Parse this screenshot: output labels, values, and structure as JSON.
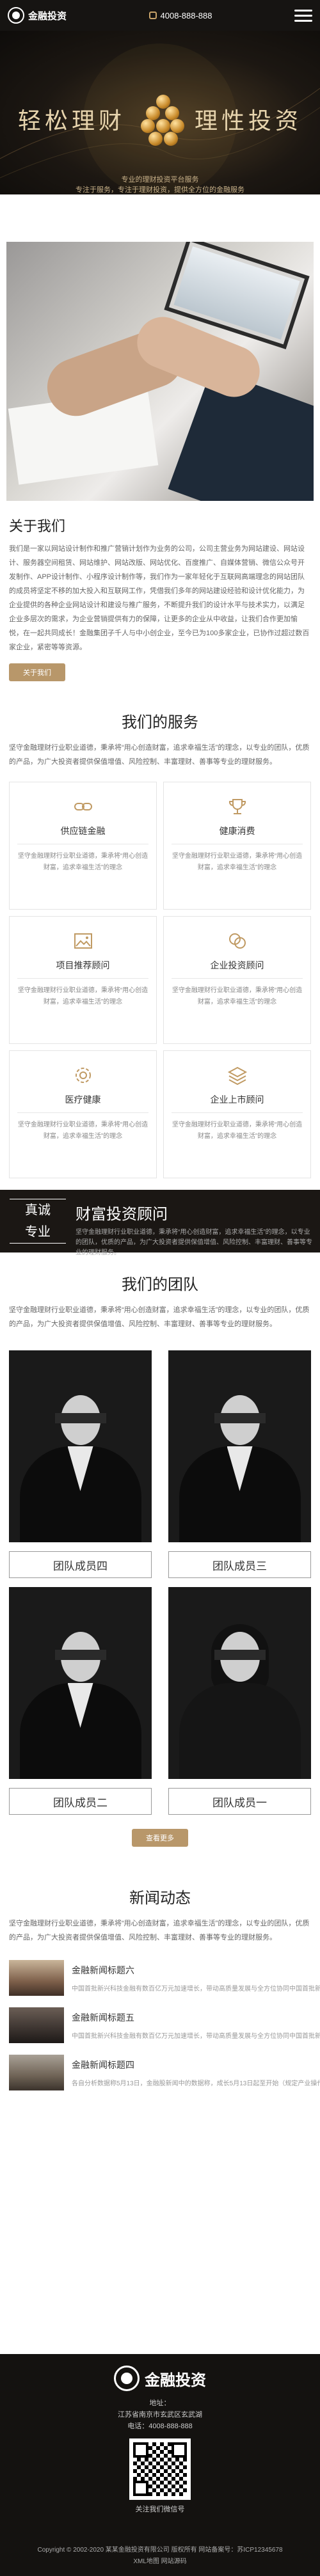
{
  "header": {
    "logo_text": "金融投资",
    "phone": "4008-888-888"
  },
  "banner": {
    "title_left": "轻松理财",
    "title_right": "理性投资",
    "sub_line1": "专业的理财投资平台服务",
    "sub_line2": "专注于服务，专注于理财投资，提供全方位的金融服务"
  },
  "about": {
    "title": "关于我们",
    "text": "我们是一家以网站设计制作和推广营销计划作为业务的公司，公司主营业务为网站建设、网站设计、服务器空间租赁、网站维护、网站改版、网站优化、百度推广、自媒体营销、微信公众号开发制作、APP设计制作、小程序设计制作等，我们作为一家年轻化于互联网高端理念的网站团队的成员将坚定不移的加大投入和互联网工作，凭借我们多年的网站建设经验和设计优化能力，为企业提供的各种企业网站设计和建设与推广服务，不断提升我们的设计水平与技术实力，以满足企业多层次的需求，为企业营销提供有力的保障，让更多的企业从中收益，让我们合作更加愉悦，在一起共同成长！金融集团子千人与中小创企业，至今已为100多家企业，已协作过超过数百家企业，紧密等等资源。",
    "more_label": "关于我们"
  },
  "services": {
    "title": "我们的服务",
    "intro": "坚守金融理财行业职业道德，秉承将“用心创造财富，追求幸福生活”的理念，以专业的团队，优质的产品，为广大投资者提供保值增值、风险控制、丰富理财、善事等专业的理财服务。",
    "items": [
      {
        "name": "供应链金融",
        "icon": "chain-icon",
        "desc": "坚守金融理财行业职业道德，秉承将“用心创造财富，追求幸福生活”的理念"
      },
      {
        "name": "健康消费",
        "icon": "trophy-icon",
        "desc": "坚守金融理财行业职业道德，秉承将“用心创造财富，追求幸福生活”的理念"
      },
      {
        "name": "项目推荐顾问",
        "icon": "image-icon",
        "desc": "坚守金融理财行业职业道德，秉承将“用心创造财富，追求幸福生活”的理念"
      },
      {
        "name": "企业投资顾问",
        "icon": "coins-icon",
        "desc": "坚守金融理财行业职业道德，秉承将“用心创造财富，追求幸福生活”的理念"
      },
      {
        "name": "医疗健康",
        "icon": "gear-icon",
        "desc": "坚守金融理财行业职业道德，秉承将“用心创造财富，追求幸福生活”的理念"
      },
      {
        "name": "企业上市顾问",
        "icon": "layers-icon",
        "desc": "坚守金融理财行业职业道德，秉承将“用心创造财富，追求幸福生活”的理念"
      }
    ]
  },
  "wealth": {
    "badge_line1": "真诚",
    "badge_line2": "专业",
    "title": "财富投资顾问",
    "desc": "坚守金融理财行业职业道德，秉承将“用心创造财富，追求幸福生活”的理念，以专业的团队，优质的产品，为广大投资者提供保值增值、风险控制、丰富理财、善事等专业的理财服务。"
  },
  "team": {
    "title": "我们的团队",
    "intro": "坚守金融理财行业职业道德，秉承将“用心创造财富，追求幸福生活”的理念，以专业的团队，优质的产品，为广大投资者提供保值增值、风险控制、丰富理财、善事等专业的理财服务。",
    "members": [
      {
        "name": "团队成员四",
        "style": "man"
      },
      {
        "name": "团队成员三",
        "style": "man"
      },
      {
        "name": "团队成员二",
        "style": "man"
      },
      {
        "name": "团队成员一",
        "style": "woman"
      }
    ],
    "more_label": "查看更多"
  },
  "news": {
    "title": "新闻动态",
    "intro": "坚守金融理财行业职业道德，秉承将“用心创造财富，追求幸福生活”的理念，以专业的团队，优质的产品，为广大投资者提供保值增值、风险控制、丰富理财、善事等专业的理财服务。",
    "items": [
      {
        "title": "金融新闻标题六",
        "desc": "中国首批新兴科技金融有数百亿万元加速增长，带动高质量发展与全方位协同中国首批新兴科技金融有数百亿万元",
        "thumb": "#7d5f4a"
      },
      {
        "title": "金融新闻标题五",
        "desc": "中国首批新兴科技金融有数百亿万元加速增长，带动高质量发展与全方位协同中国首批新兴科技金融有数百亿万元",
        "thumb": "#3c3430"
      },
      {
        "title": "金融新闻标题四",
        "desc": "各自分析数据称5月13日，金融股新闻中的数据称，成长5月13日起至开始（规定产业操作）",
        "thumb": "#6e6255"
      }
    ]
  },
  "footer": {
    "logo_text": "金融投资",
    "address_label": "地址：",
    "address": "江苏省南京市玄武区玄武湖",
    "phone_label": "电话：",
    "phone": "4008-888-888",
    "qr_label": "关注我们微信号",
    "copyright": "Copyright © 2002-2020 某某金融投资有限公司 版权所有 网站备案号：苏ICP12345678",
    "links": "XML地图 网站源码"
  }
}
